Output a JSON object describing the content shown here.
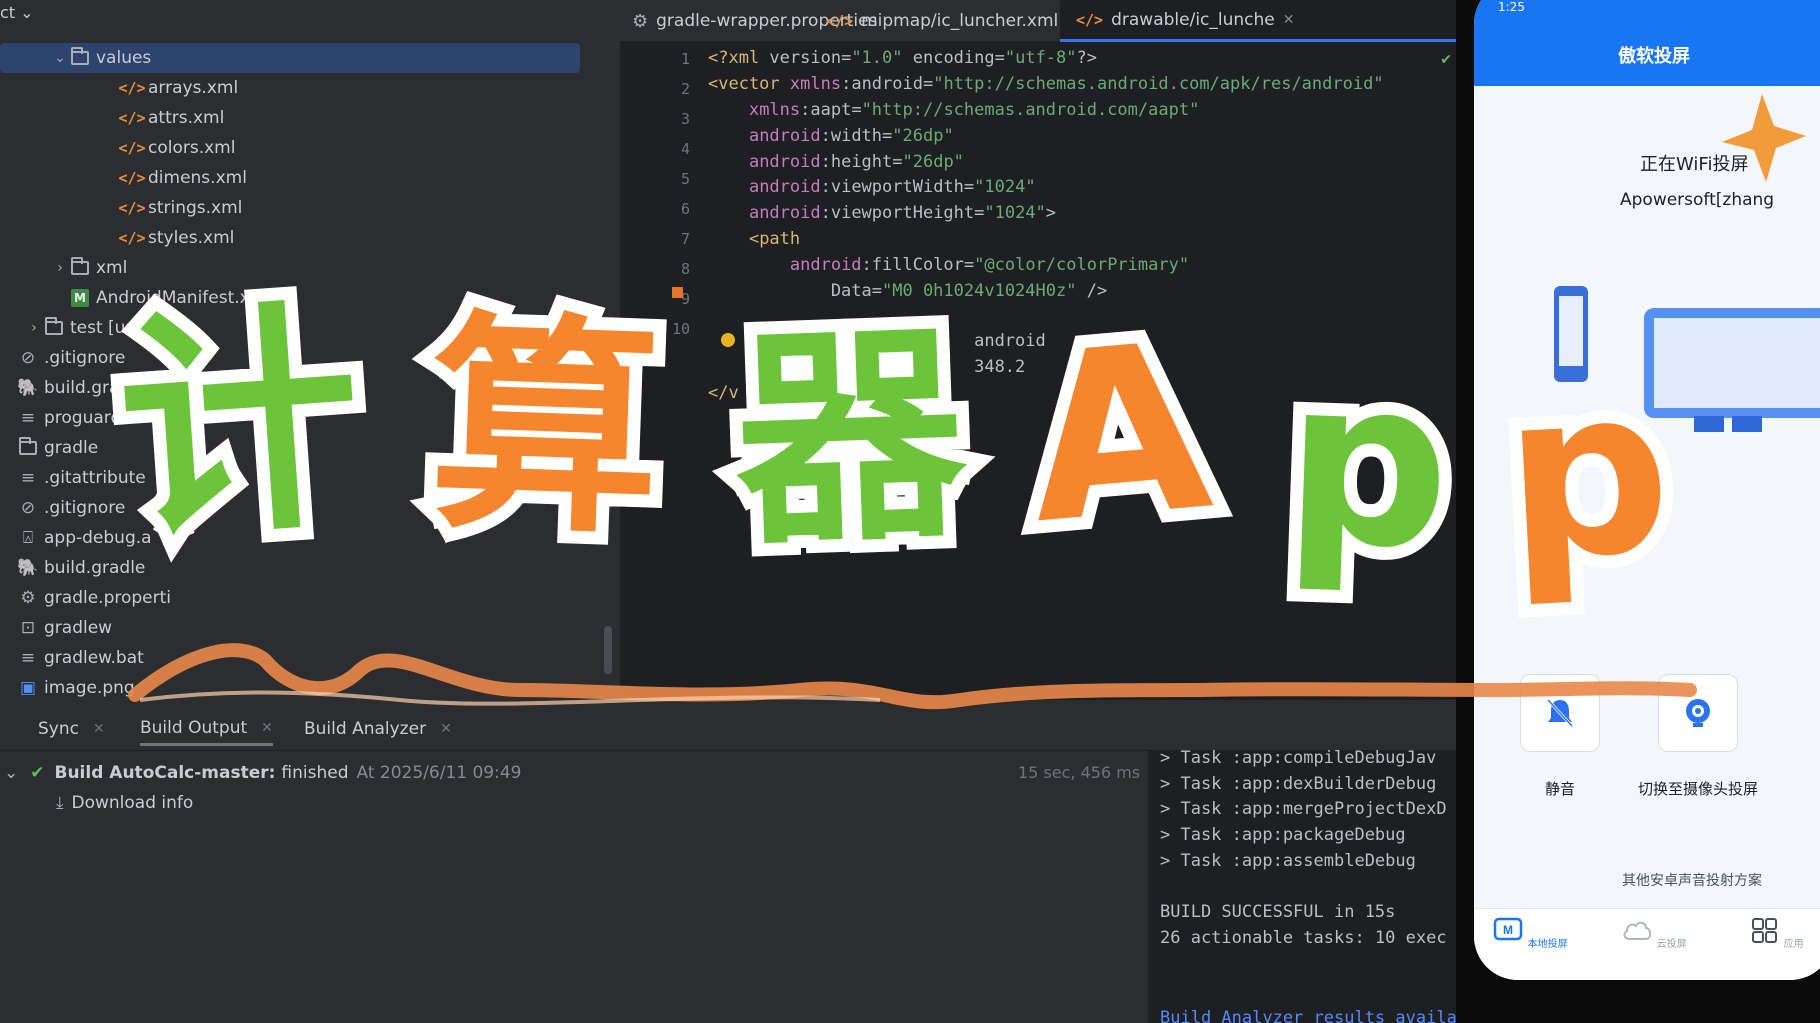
{
  "project_tree": {
    "header_label": "ct",
    "items": [
      {
        "label": "values",
        "type": "folder",
        "indent": 2,
        "expanded": true,
        "selected": true
      },
      {
        "label": "arrays.xml",
        "type": "xml",
        "indent": 4
      },
      {
        "label": "attrs.xml",
        "type": "xml",
        "indent": 4
      },
      {
        "label": "colors.xml",
        "type": "xml",
        "indent": 4
      },
      {
        "label": "dimens.xml",
        "type": "xml",
        "indent": 4
      },
      {
        "label": "strings.xml",
        "type": "xml",
        "indent": 4
      },
      {
        "label": "styles.xml",
        "type": "xml",
        "indent": 4
      },
      {
        "label": "xml",
        "type": "folder",
        "indent": 2,
        "expanded": false
      },
      {
        "label": "AndroidManifest.xml",
        "type": "manifest",
        "indent": 2
      },
      {
        "label": "test [unitTest]",
        "type": "folder",
        "indent": 1,
        "expanded": false
      },
      {
        "label": ".gitignore",
        "type": "ignore",
        "indent": 0
      },
      {
        "label": "build.gra",
        "type": "gradle",
        "indent": 0
      },
      {
        "label": "proguard-",
        "type": "file",
        "indent": 0
      },
      {
        "label": "gradle",
        "type": "folder",
        "indent": 0
      },
      {
        "label": ".gitattribute",
        "type": "file",
        "indent": 0
      },
      {
        "label": ".gitignore",
        "type": "ignore",
        "indent": 0
      },
      {
        "label": "app-debug.a",
        "type": "apk",
        "indent": 0
      },
      {
        "label": "build.gradle",
        "type": "gradle",
        "indent": 0
      },
      {
        "label": "gradle.properti",
        "type": "settings",
        "indent": 0
      },
      {
        "label": "gradlew",
        "type": "shell",
        "indent": 0
      },
      {
        "label": "gradlew.bat",
        "type": "file",
        "indent": 0
      },
      {
        "label": "image.png",
        "type": "image",
        "indent": 0
      }
    ]
  },
  "editor": {
    "tabs": [
      {
        "label": "gradle-wrapper.properties",
        "icon": "gear-icon"
      },
      {
        "label": "mipmap/ic_luncher.xml",
        "icon": "xml-icon"
      },
      {
        "label": "drawable/ic_lunche",
        "icon": "xml-icon",
        "active": true
      }
    ],
    "line_numbers": [
      "1",
      "2",
      "3",
      "4",
      "5",
      "6",
      "7",
      "8",
      "9",
      "10"
    ],
    "lines": [
      "<?xml version=\"1.0\" encoding=\"utf-8\"?>",
      "<vector xmlns:android=\"http://schemas.android.com/apk/res/android\"",
      "    xmlns:aapt=\"http://schemas.android.com/aapt\"",
      "    android:width=\"26dp\"",
      "    android:height=\"26dp\"",
      "    android:viewportWidth=\"1024\"",
      "    android:viewportHeight=\"1024\">",
      "    <path",
      "        android:fillColor=\"@color/colorPrimary\"",
      "            Data=\"M0 0h1024v1024H0z\" />",
      "                          android",
      "                          348.2",
      "</v"
    ]
  },
  "build_panel": {
    "tabs": [
      "Sync",
      "Build Output",
      "Build Analyzer"
    ],
    "active_tab": "Build Output",
    "result_title": "Build AutoCalc-master:",
    "result_status": "finished",
    "result_time": "At 2025/6/11 09:49",
    "duration": "15 sec, 456 ms",
    "download_label": "Download info",
    "console_lines": [
      "> Task :app:compileDebugJav",
      "> Task :app:dexBuilderDebug",
      "> Task :app:mergeProjectDexD",
      "> Task :app:packageDebug",
      "> Task :app:assembleDebug",
      "",
      "BUILD SUCCESSFUL in 15s",
      "26 actionable tasks: 10 exec"
    ],
    "console_link": "Build Analyzer results available"
  },
  "phone": {
    "status_time": "1:25",
    "title": "傲软投屏",
    "hero_line1": "正在WiFi投屏",
    "hero_line2": "Apowersoft[zhang",
    "controls": [
      {
        "label": "静音",
        "icon": "mute-bell-icon"
      },
      {
        "label": "切换至摄像头投屏",
        "icon": "camera-icon"
      }
    ],
    "other_link": "其他安卓声音投射方案",
    "nav": [
      {
        "label": "本地投屏",
        "active": true
      },
      {
        "label": "云投屏"
      },
      {
        "label": "应用"
      }
    ]
  },
  "overlay_title": {
    "chars": [
      "计",
      "算",
      "器",
      "A",
      "p",
      "p"
    ],
    "colors": [
      "green",
      "orange",
      "green",
      "orange",
      "green",
      "orange"
    ]
  }
}
